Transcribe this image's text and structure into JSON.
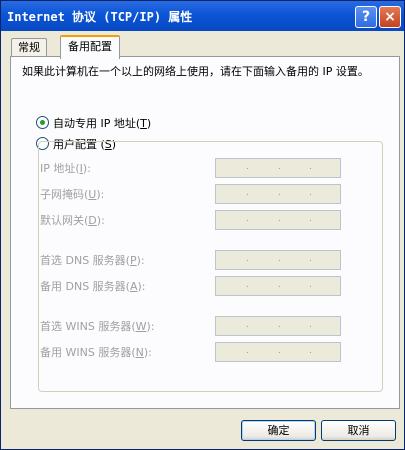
{
  "window": {
    "title": "Internet 协议 (TCP/IP) 属性",
    "help_glyph": "?",
    "close_glyph": "×"
  },
  "tabs": [
    {
      "label": "常规",
      "selected": false
    },
    {
      "label": "备用配置",
      "selected": true
    }
  ],
  "description": "如果此计算机在一个以上的网络上使用，请在下面输入备用的 IP 设置。",
  "radio_auto": {
    "label": "自动专用 IP 地址(",
    "key": "T",
    "suffix": ")",
    "checked": true
  },
  "radio_user": {
    "label": "用户配置 (",
    "key": "S",
    "suffix": ")",
    "checked": false
  },
  "fields": [
    {
      "label": "IP 地址(",
      "key": "I",
      "suffix": "):"
    },
    {
      "label": "子网掩码(",
      "key": "U",
      "suffix": "):"
    },
    {
      "label": "默认网关(",
      "key": "D",
      "suffix": "):"
    },
    {
      "label": "首选 DNS 服务器(",
      "key": "P",
      "suffix": "):"
    },
    {
      "label": "备用 DNS 服务器(",
      "key": "A",
      "suffix": "):"
    },
    {
      "label": "首选 WINS 服务器(",
      "key": "W",
      "suffix": "):"
    },
    {
      "label": "备用 WINS 服务器(",
      "key": "N",
      "suffix": "):"
    }
  ],
  "ip_separator": ".",
  "buttons": {
    "ok": "确定",
    "cancel": "取消"
  }
}
